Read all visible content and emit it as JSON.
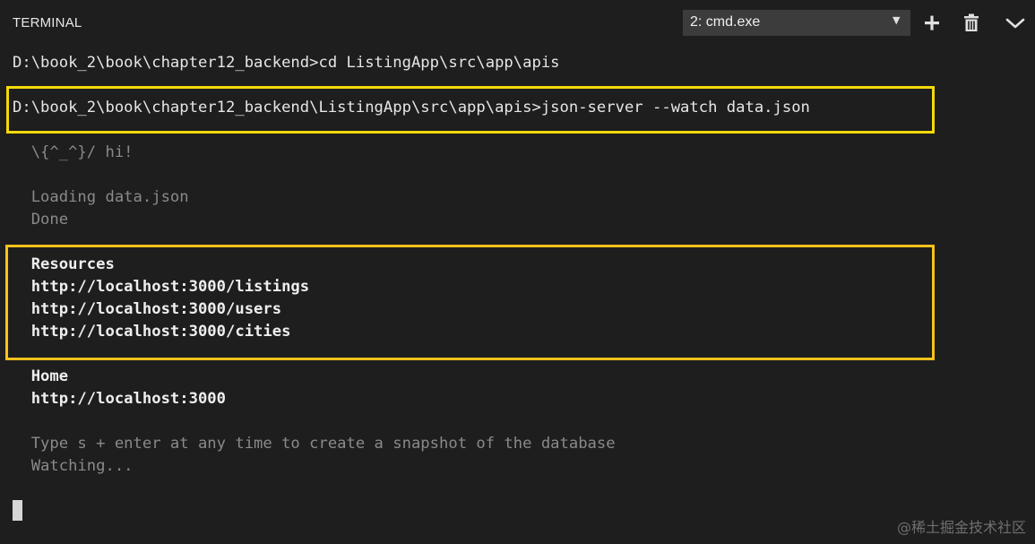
{
  "panel": {
    "title": "TERMINAL",
    "selected_terminal": "2: cmd.exe",
    "icons": [
      "chevron-down-icon",
      "plus-icon",
      "trash-icon",
      "chevron-down-icon"
    ]
  },
  "terminal": {
    "lines": [
      "D:\\book_2\\book\\chapter12_backend>cd ListingApp\\src\\app\\apis",
      "D:\\book_2\\book\\chapter12_backend\\ListingApp\\src\\app\\apis>json-server --watch data.json",
      "  \\{^_^}/ hi!",
      "  Loading data.json",
      "  Done",
      "  Resources",
      "  http://localhost:3000/listings",
      "  http://localhost:3000/users",
      "  http://localhost:3000/cities",
      "  Home",
      "  http://localhost:3000",
      "  Type s + enter at any time to create a snapshot of the database",
      "  Watching..."
    ]
  },
  "colors": {
    "background": "#1e1e1e",
    "highlight_command": "#f5d90a",
    "highlight_resources": "#f7c21a"
  },
  "watermark": "@稀土掘金技术社区"
}
